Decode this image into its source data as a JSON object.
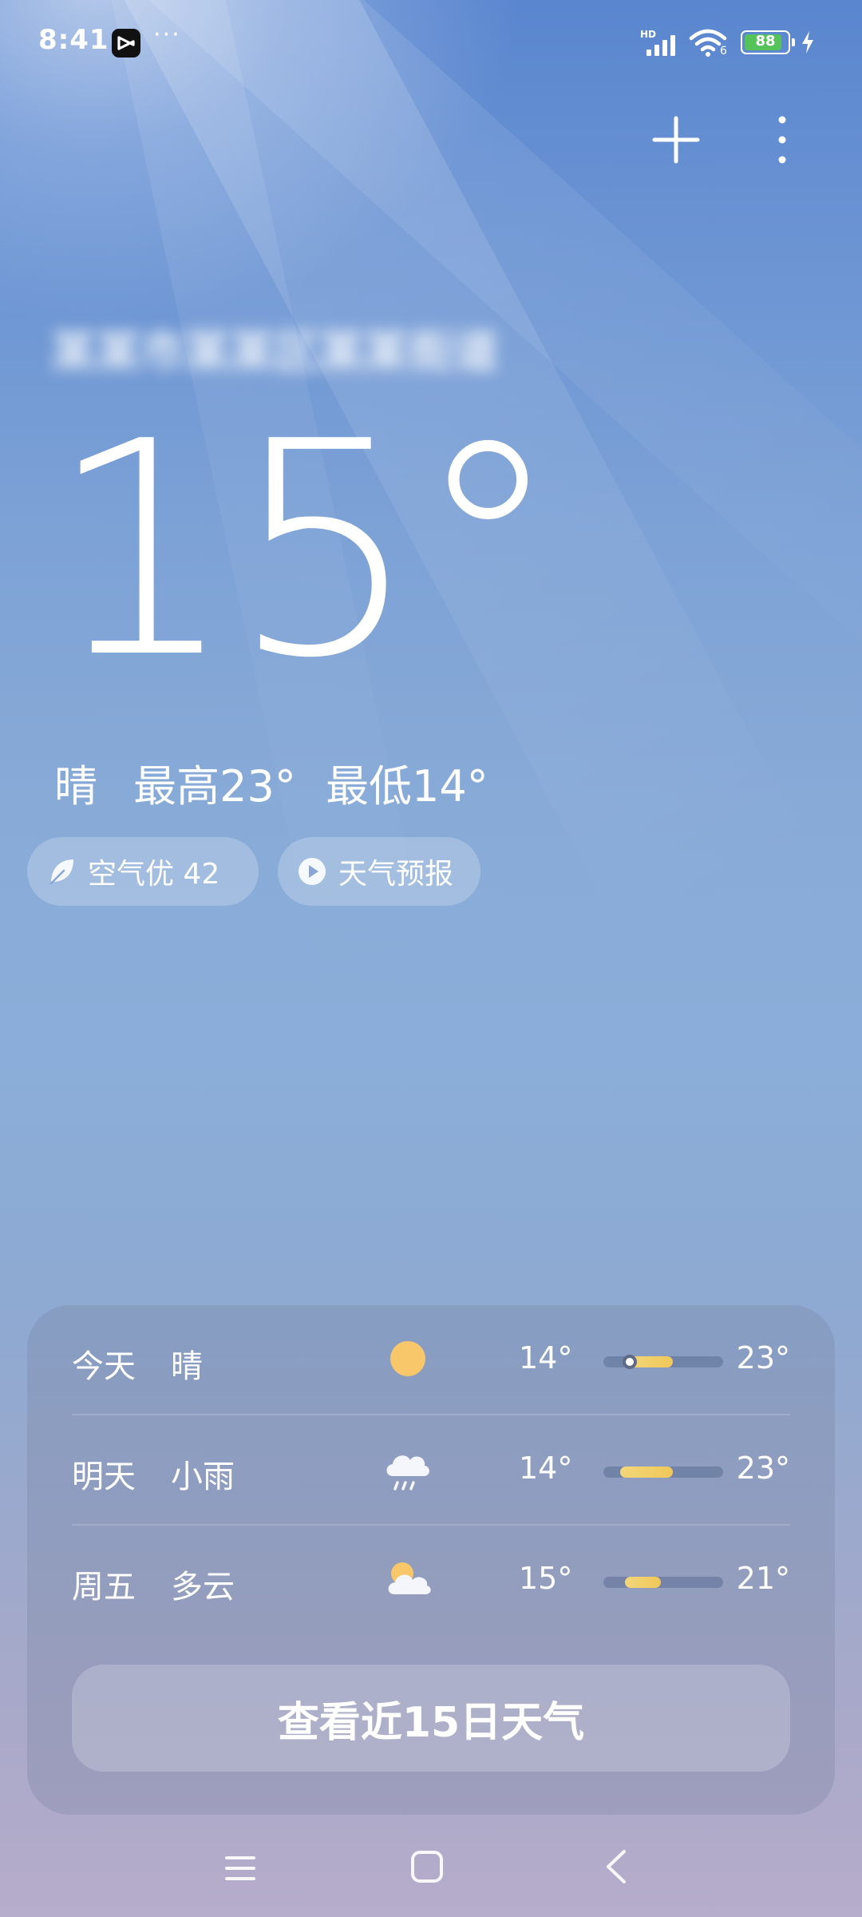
{
  "status_bar": {
    "time": "8:41",
    "more_indicator": "···",
    "network_label": "HD",
    "wifi_label": "6",
    "battery_level": "88",
    "battery_fraction": 0.88
  },
  "location": {
    "name": "某某市某某区某某街道"
  },
  "current": {
    "temperature": "15°",
    "condition": "晴",
    "high": "最高23°",
    "low": "最低14°"
  },
  "chips": {
    "aqi_label": "空气优 42",
    "forecast_label": "天气预报"
  },
  "forecast": {
    "rows": [
      {
        "day": "今天",
        "condition": "晴",
        "icon": "sun-icon",
        "low": "14°",
        "high": "23°",
        "range_start": 0.18,
        "range_end": 0.58,
        "current_marker": 0.22
      },
      {
        "day": "明天",
        "condition": "小雨",
        "icon": "rain-cloud-icon",
        "low": "14°",
        "high": "23°",
        "range_start": 0.14,
        "range_end": 0.58
      },
      {
        "day": "周五",
        "condition": "多云",
        "icon": "partly-cloudy-icon",
        "low": "15°",
        "high": "21°",
        "range_start": 0.18,
        "range_end": 0.48
      }
    ],
    "view_more_label": "查看近15日天气"
  },
  "colors": {
    "sun": "#f7c76a",
    "range_fill": "#f0c85a",
    "battery": "#56c35a"
  }
}
